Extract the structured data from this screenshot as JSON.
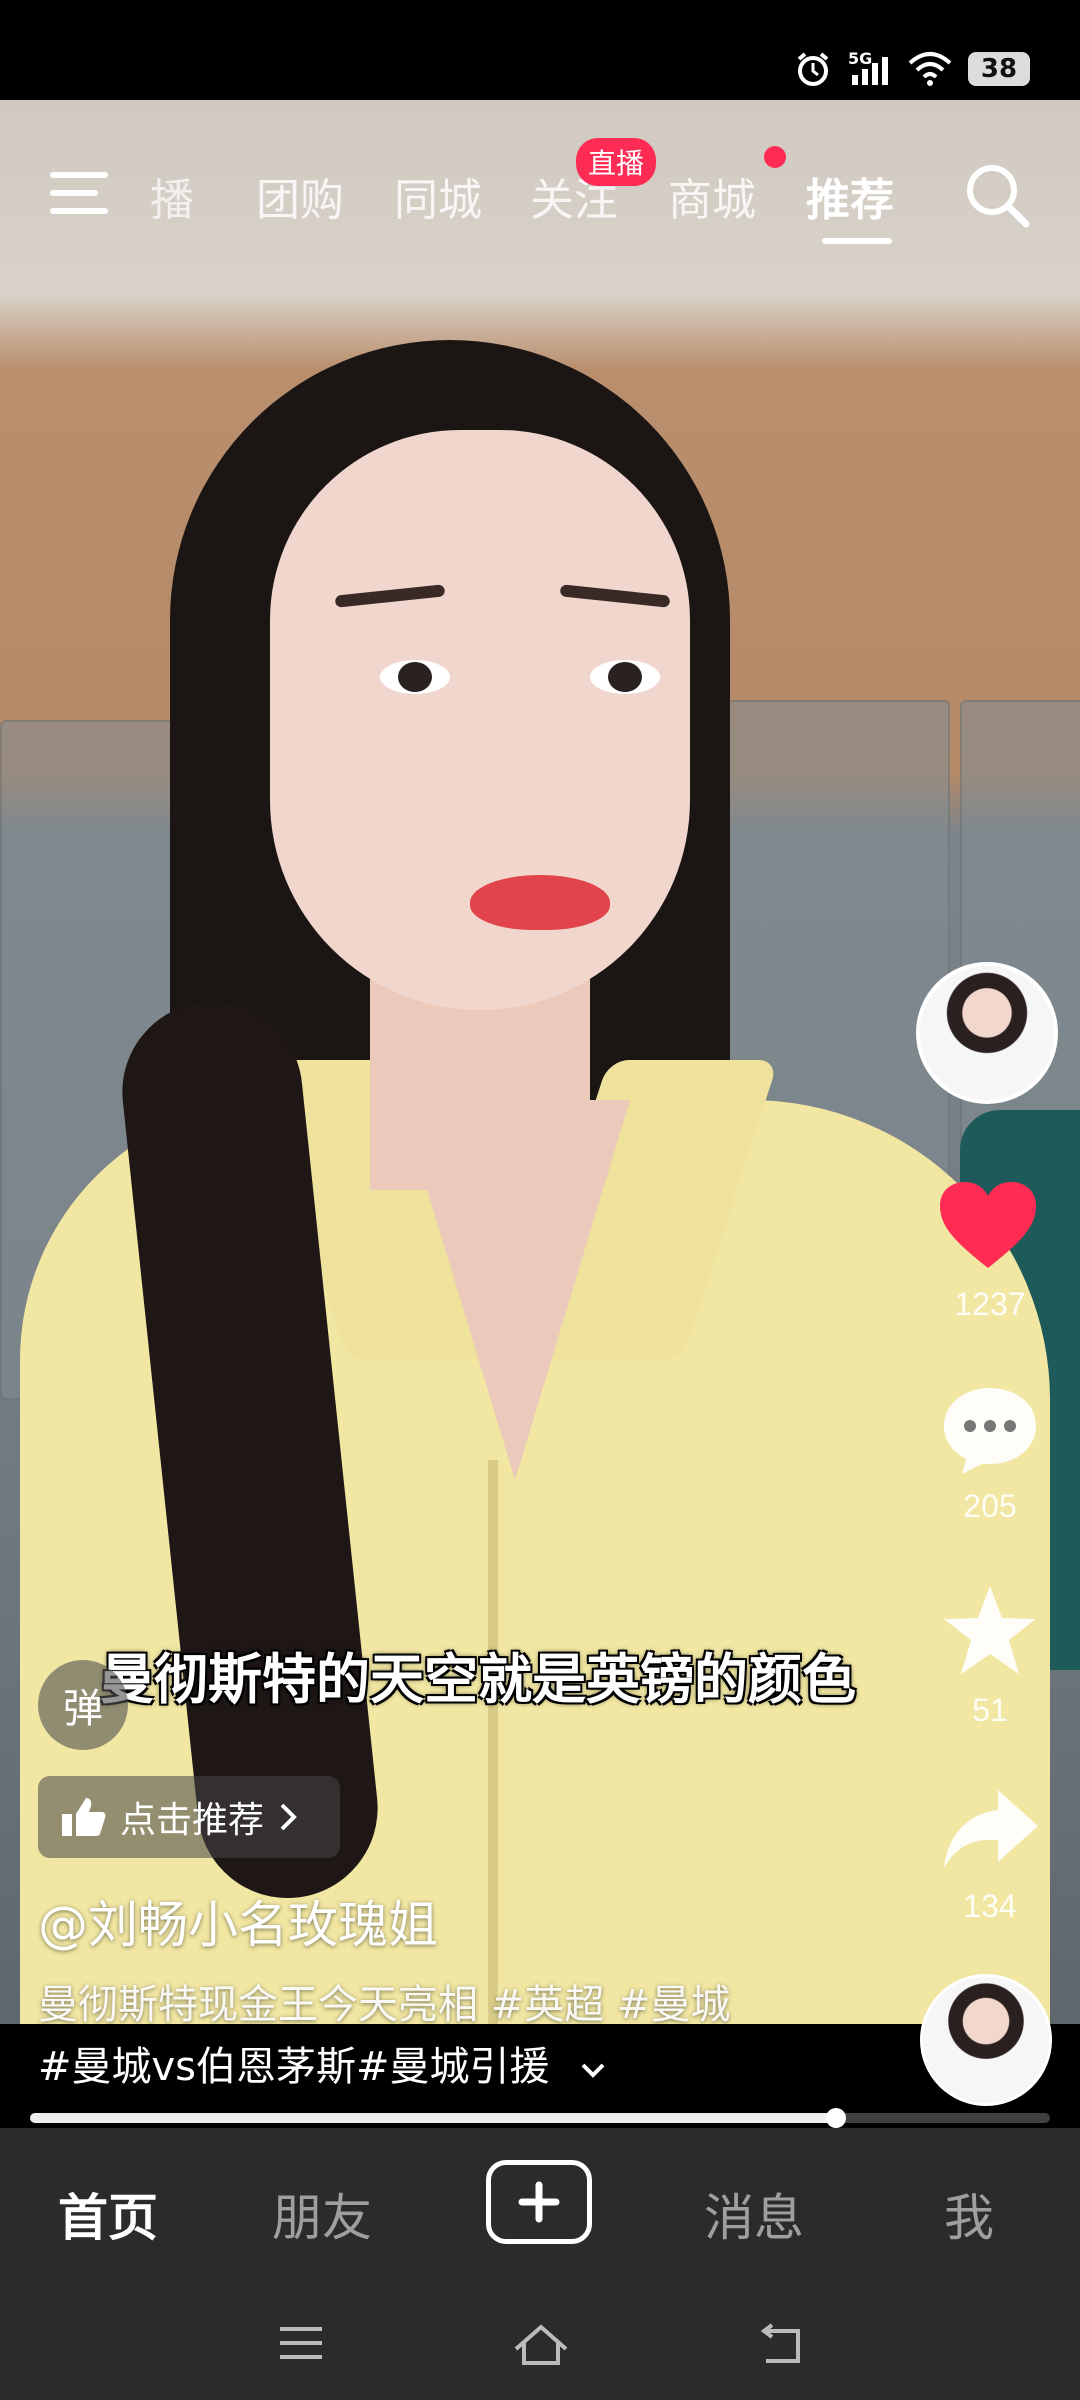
{
  "status_bar": {
    "network": "5G",
    "battery": "38"
  },
  "top_nav": {
    "tabs": [
      {
        "label": "播",
        "active": false
      },
      {
        "label": "团购",
        "active": false
      },
      {
        "label": "同城",
        "active": false
      },
      {
        "label": "关注",
        "active": false
      },
      {
        "label": "商城",
        "active": false
      },
      {
        "label": "推荐",
        "active": true
      }
    ],
    "live_badge": "直播"
  },
  "video": {
    "subtitle": "曼彻斯特的天空就是英镑的颜色",
    "danmu_label": "弹",
    "recommend_label": "点击推荐",
    "author": "@刘畅小名玫瑰姐",
    "description_line1": "曼彻斯特现金王今天亮相 #英超 #曼城",
    "description_line2": "#曼城vs伯恩茅斯#曼城引援",
    "progress": 0.79
  },
  "right_rail": {
    "likes": "1237",
    "comments": "205",
    "favorites": "51",
    "shares": "134"
  },
  "bottom_tabs": {
    "home": "首页",
    "friends": "朋友",
    "messages": "消息",
    "me": "我"
  },
  "colors": {
    "accent": "#fe2c55",
    "tab_bar": "#2b2b2b"
  }
}
